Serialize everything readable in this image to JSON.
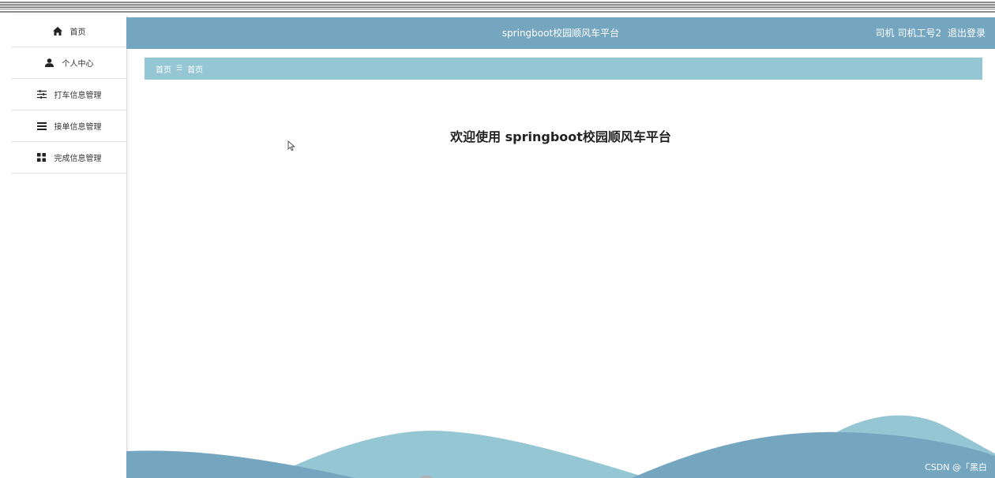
{
  "header": {
    "app_title": "springboot校园顺风车平台",
    "user_role": "司机",
    "user_name": "司机工号2",
    "logout_label": "退出登录"
  },
  "sidebar": {
    "items": [
      {
        "label": "首页",
        "icon": "home-icon"
      },
      {
        "label": "个人中心",
        "icon": "user-icon"
      },
      {
        "label": "打车信息管理",
        "icon": "sliders-icon"
      },
      {
        "label": "接单信息管理",
        "icon": "list-icon"
      },
      {
        "label": "完成信息管理",
        "icon": "grid-icon"
      }
    ]
  },
  "breadcrumb": {
    "root": "首页",
    "separator": "☰",
    "current": "首页"
  },
  "main": {
    "welcome_text": "欢迎使用 springboot校园顺风车平台"
  },
  "watermark": {
    "text": "CSDN @「黑白"
  },
  "colors": {
    "header_bg": "#74a6c0",
    "breadcrumb_bg": "#95c6d4",
    "wave_light": "#95c6d4",
    "wave_dark": "#74a6c0"
  }
}
